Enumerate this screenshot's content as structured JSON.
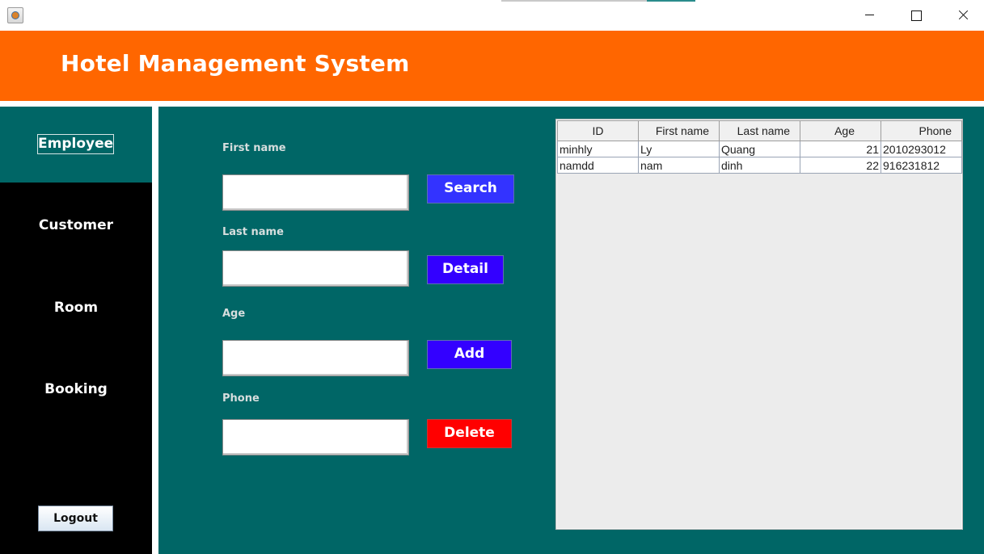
{
  "header": {
    "title": "Hotel Management System"
  },
  "sidebar": {
    "items": [
      {
        "label": "Employee"
      },
      {
        "label": "Customer"
      },
      {
        "label": "Room"
      },
      {
        "label": "Booking"
      }
    ],
    "logout_label": "Logout"
  },
  "form": {
    "first_name_label": "First name",
    "first_name_value": "",
    "last_name_label": "Last name",
    "last_name_value": "",
    "age_label": "Age",
    "age_value": "",
    "phone_label": "Phone",
    "phone_value": ""
  },
  "actions": {
    "search_label": "Search",
    "detail_label": "Detail",
    "add_label": "Add",
    "delete_label": "Delete"
  },
  "table": {
    "columns": [
      "ID",
      "First name",
      "Last name",
      "Age",
      "Phone"
    ],
    "rows": [
      [
        "minhly",
        "Ly",
        "Quang",
        "21",
        "2010293012"
      ],
      [
        "namdd",
        "nam",
        "dinh",
        "22",
        "916231812"
      ]
    ]
  },
  "colors": {
    "header": "#ff6600",
    "sidebar": "#000000",
    "active_nav": "#006666",
    "panel": "#006666",
    "search_button": "#3333ff",
    "primary_button": "#3300ff",
    "delete_button": "#ff0000"
  },
  "icons": {
    "app": "java-app-icon",
    "minimize": "minimize-icon",
    "maximize": "maximize-icon",
    "close": "close-icon"
  }
}
